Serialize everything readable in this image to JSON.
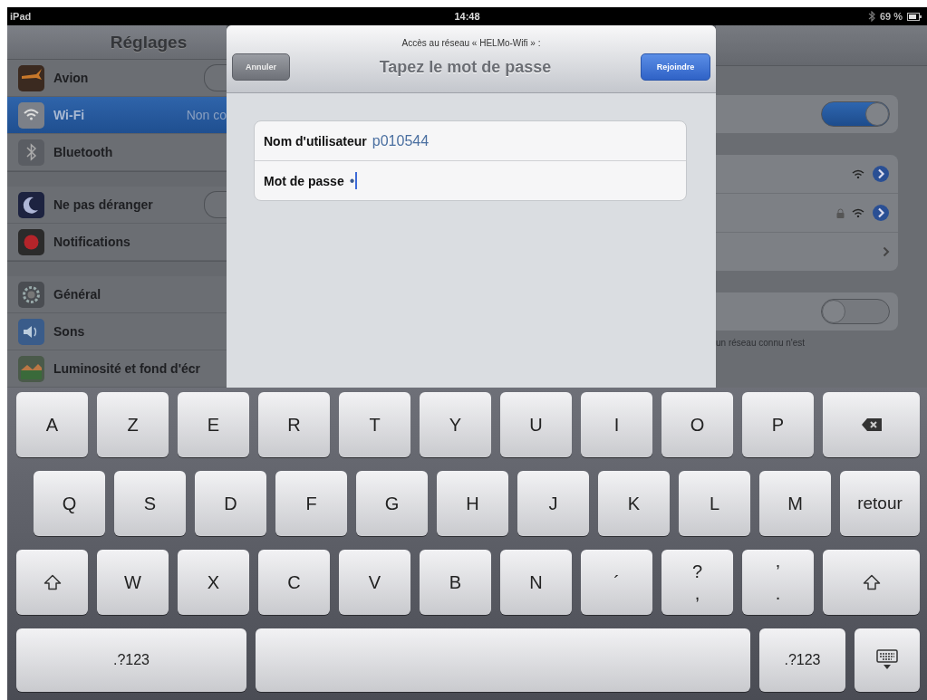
{
  "status_bar": {
    "device": "iPad",
    "time": "14:48",
    "battery": "69 %"
  },
  "sidebar": {
    "title": "Réglages",
    "sections": [
      [
        {
          "label": "Avion",
          "kind": "toggle",
          "on": false
        },
        {
          "label": "Wi-Fi",
          "kind": "value",
          "value": "Non co",
          "selected": true
        },
        {
          "label": "Bluetooth",
          "kind": "plain",
          "selected": false
        }
      ],
      [
        {
          "label": "Ne pas déranger",
          "kind": "toggle",
          "on": false
        },
        {
          "label": "Notifications",
          "kind": "plain",
          "selected": false
        }
      ],
      [
        {
          "label": "Général",
          "kind": "plain",
          "selected": false
        },
        {
          "label": "Sons",
          "kind": "plain",
          "selected": false
        },
        {
          "label": "Luminosité et fond d'écr",
          "kind": "plain",
          "selected": false
        }
      ]
    ]
  },
  "dialog": {
    "subtitle": "Accès au réseau « HELMo-Wifi » :",
    "title": "Tapez le mot de passe",
    "cancel": "Annuler",
    "join": "Rejoindre",
    "fields": [
      {
        "label": "Nom d'utilisateur",
        "value": "p010544",
        "focused": false
      },
      {
        "label": "Mot de passe",
        "value": "•",
        "focused": true
      }
    ]
  },
  "detail": {
    "sections": [
      [
        {
          "kind": "toggle",
          "on": true
        }
      ],
      [
        {
          "kind": "network",
          "locked": false
        },
        {
          "kind": "network",
          "locked": true
        },
        {
          "kind": "disclosure"
        }
      ],
      [
        {
          "kind": "toggle",
          "on": false
        }
      ]
    ],
    "footer": "un réseau connu n'est"
  },
  "keyboard": {
    "rows": [
      {
        "keys": [
          {
            "kind": "char",
            "label": "A"
          },
          {
            "kind": "char",
            "label": "Z"
          },
          {
            "kind": "char",
            "label": "E"
          },
          {
            "kind": "char",
            "label": "R"
          },
          {
            "kind": "char",
            "label": "T"
          },
          {
            "kind": "char",
            "label": "Y"
          },
          {
            "kind": "char",
            "label": "U"
          },
          {
            "kind": "char",
            "label": "I"
          },
          {
            "kind": "char",
            "label": "O"
          },
          {
            "kind": "char",
            "label": "P"
          },
          {
            "kind": "backspace"
          }
        ]
      },
      {
        "keys": [
          {
            "kind": "char",
            "label": "Q"
          },
          {
            "kind": "char",
            "label": "S"
          },
          {
            "kind": "char",
            "label": "D"
          },
          {
            "kind": "char",
            "label": "F"
          },
          {
            "kind": "char",
            "label": "G"
          },
          {
            "kind": "char",
            "label": "H"
          },
          {
            "kind": "char",
            "label": "J"
          },
          {
            "kind": "char",
            "label": "K"
          },
          {
            "kind": "char",
            "label": "L"
          },
          {
            "kind": "char",
            "label": "M"
          },
          {
            "kind": "return",
            "label": "retour"
          }
        ]
      },
      {
        "keys": [
          {
            "kind": "shift"
          },
          {
            "kind": "char",
            "label": "W"
          },
          {
            "kind": "char",
            "label": "X"
          },
          {
            "kind": "char",
            "label": "C"
          },
          {
            "kind": "char",
            "label": "V"
          },
          {
            "kind": "char",
            "label": "B"
          },
          {
            "kind": "char",
            "label": "N"
          },
          {
            "kind": "char",
            "label": "´"
          },
          {
            "kind": "dual",
            "top": "?",
            "bottom": ","
          },
          {
            "kind": "dual",
            "top": "’",
            "bottom": "."
          },
          {
            "kind": "shift"
          }
        ]
      },
      {
        "keys": [
          {
            "kind": "mode",
            "label": ".?123"
          },
          {
            "kind": "space"
          },
          {
            "kind": "mode",
            "label": ".?123"
          },
          {
            "kind": "hide"
          }
        ]
      }
    ]
  }
}
